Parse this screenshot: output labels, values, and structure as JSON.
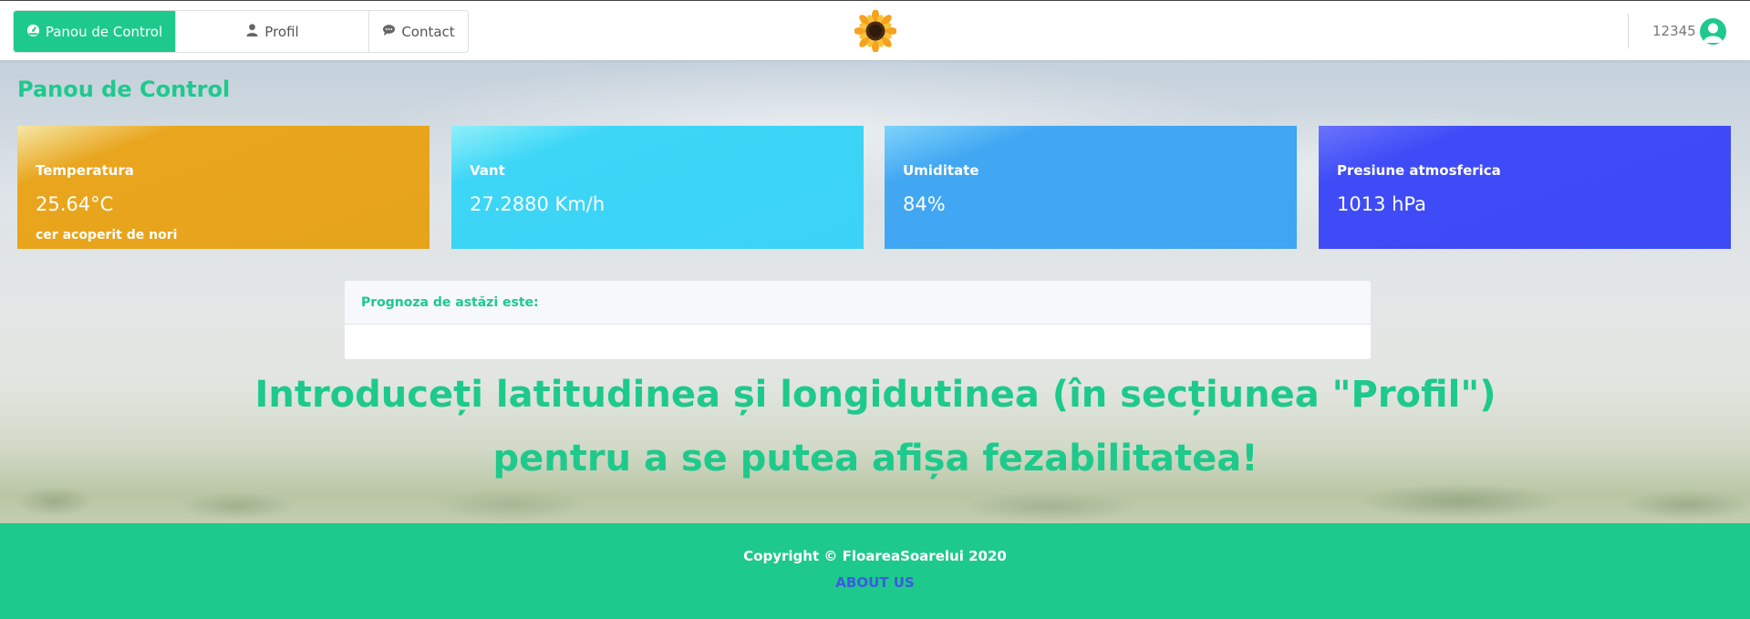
{
  "nav": {
    "tabs": [
      {
        "label": "Panou de Control",
        "icon": "dashboard-icon",
        "active": true
      },
      {
        "label": "Profil",
        "icon": "user-icon",
        "active": false
      },
      {
        "label": "Contact",
        "icon": "comments-icon",
        "active": false
      }
    ],
    "logo_icon": "sunflower-logo",
    "user_name": "12345",
    "avatar_icon": "user-avatar-icon"
  },
  "page": {
    "title": "Panou de Control"
  },
  "cards": [
    {
      "label": "Temperatura",
      "value": "25.64°C",
      "description": "cer acoperit de nori",
      "color": "#e6a41b"
    },
    {
      "label": "Vant",
      "value": "27.2880 Km/h",
      "color": "#3bd2f5"
    },
    {
      "label": "Umiditate",
      "value": "84%",
      "color": "#40a5f2"
    },
    {
      "label": "Presiune atmosferica",
      "value": "1013 hPa",
      "color": "#3d4af5"
    }
  ],
  "forecast": {
    "header": "Prognoza de astăzi este:",
    "body": ""
  },
  "message": "Introduceți latitudinea și longidutinea (în secțiunea \"Profil\") pentru a se putea afișa fezabilitatea!",
  "footer": {
    "copyright": "Copyright © FloareaSoarelui 2020",
    "about_label": "ABOUT US"
  },
  "colors": {
    "accent": "#1ec98c",
    "link": "#3e58e6"
  }
}
